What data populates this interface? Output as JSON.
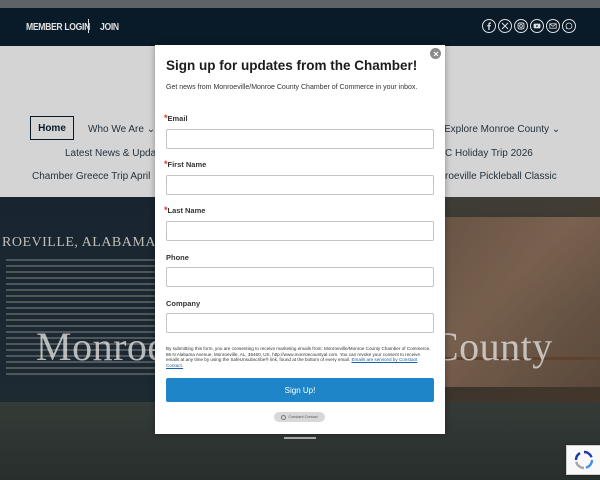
{
  "header": {
    "member_login": "MEMBER LOGIN",
    "join": "JOIN",
    "social_icons": [
      "facebook-icon",
      "x-icon",
      "instagram-icon",
      "youtube-icon",
      "email-icon",
      "whatsapp-icon"
    ]
  },
  "nav": {
    "home": "Home",
    "who_we_are": "Who We Are",
    "explore": "Explore Monroe County",
    "latest_news": "Latest News & Upda",
    "holiday_trip": "C Holiday Trip 2026",
    "greece_trip": "Chamber Greece Trip April",
    "pickleball": "roeville Pickleball Classic",
    "chevron": "⌄"
  },
  "hero": {
    "title": "Monroeville & Monroe County",
    "sign_text": "ROEVILLE, ALABAMA"
  },
  "modal": {
    "title": "Sign up for updates from the Chamber!",
    "description": "Get news from Monroeville/Monroe County Chamber of Commerce in your inbox.",
    "required_mark": "*",
    "fields": {
      "email": "Email",
      "first_name": "First Name",
      "last_name": "Last Name",
      "phone": "Phone",
      "company": "Company"
    },
    "consent": "By submitting this form, you are consenting to receive marketing emails from: Monroeville/Monroe County Chamber of Commerce, 86 N Alabama Avenue, Monroeville, AL, 36460, US, http://www.monroecountyal.com. You can revoke your consent to receive emails at any time by using the SafeUnsubscribe® link, found at the bottom of every email.",
    "consent_link": "Emails are serviced by Constant Contact.",
    "submit": "Sign Up!",
    "badge": "Constant Contact"
  },
  "colors": {
    "header_bg": "#0b1f2e",
    "submit_bg": "#1e86c8",
    "required": "#e0302c"
  }
}
